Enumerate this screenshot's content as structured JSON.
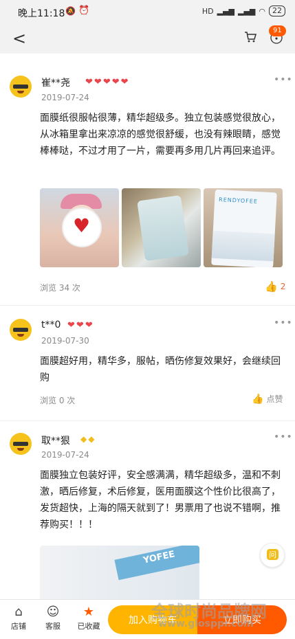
{
  "status": {
    "time": "晚上11:18",
    "network": "HD",
    "battery": "22"
  },
  "nav": {
    "back": "<",
    "message_badge": "91"
  },
  "reviews": [
    {
      "user": "崔**尧",
      "date": "2019-07-24",
      "text": "面膜纸很服帖很薄，精华超级多。独立包装感觉很放心，从冰箱里拿出来凉凉的感觉很舒缓，也没有辣眼睛，感觉棒棒哒，不过才用了一片，需要再多用几片再回来追评。",
      "views": "浏览 34 次",
      "likes": "2",
      "photo_brand": "RENDYOFEE"
    },
    {
      "user": "t**0",
      "date": "2019-07-30",
      "text": "面膜超好用，精华多，服帖，晒伤修复效果好，会继续回购",
      "views": "浏览 0 次",
      "likes": "点赞"
    },
    {
      "user": "取**狠",
      "date": "2019-07-24",
      "text": "面膜独立包装好评，安全感满满，精华超级多，温和不刺激，晒后修复，术后修复，医用面膜这个性价比很高了，发货超快，上海的隔天就到了！男票用了也说不错啊，推荐购买！！！",
      "photo_brand": "YOFEE"
    }
  ],
  "float_button": "问",
  "bottom": {
    "store": "店铺",
    "service": "客服",
    "favorited": "已收藏",
    "add_cart": "加入购物车",
    "buy_now": "立即购买"
  },
  "watermark": {
    "line1": "全球时尚品牌网",
    "line2": "www.glosppr.com"
  },
  "colors": {
    "accent": "#ff5a00",
    "cart_button": "#ffb400",
    "heart": "#e8454d"
  }
}
